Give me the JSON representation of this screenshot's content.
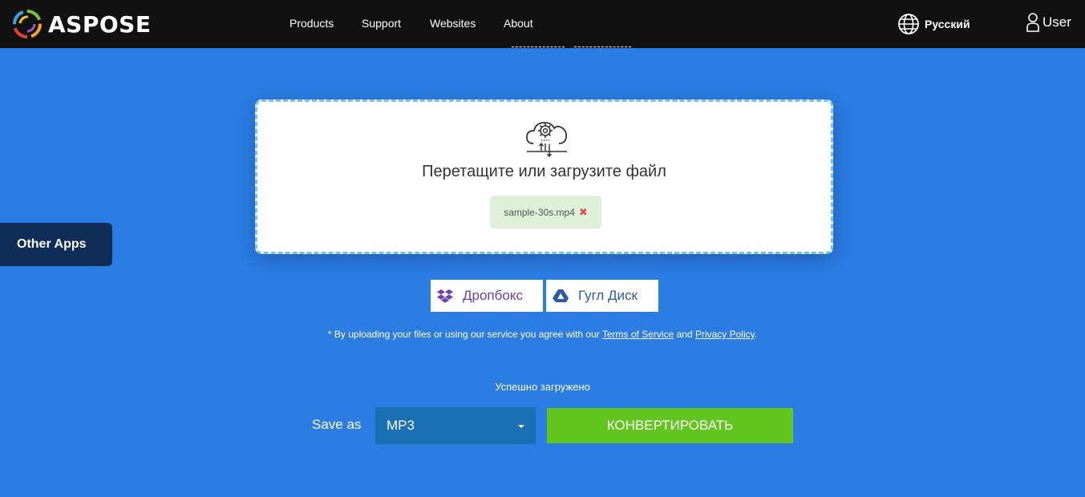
{
  "header": {
    "brand": "ASPOSE",
    "nav": [
      {
        "label": "Products"
      },
      {
        "label": "Support"
      },
      {
        "label": "Websites"
      },
      {
        "label": "About"
      }
    ],
    "language": "Русский",
    "user": "User"
  },
  "sidebar": {
    "other_apps": "Other Apps"
  },
  "dropzone": {
    "title": "Перетащите или загрузите файл",
    "file_name": "sample-30s.mp4",
    "remove_symbol": "✖"
  },
  "cloud": {
    "dropbox": "Дропбокс",
    "gdrive": "Гугл Диск"
  },
  "terms": {
    "prefix": "* By uploading your files or using our service you agree with our",
    "tos": "Terms of Service",
    "and": "and",
    "privacy": "Privacy Policy",
    "suffix": "."
  },
  "status": "Успешно загружено",
  "convert": {
    "save_as_label": "Save as",
    "format": "MP3",
    "button": "КОНВЕРТИРОВАТЬ"
  },
  "colors": {
    "background": "#2b7ce3",
    "header": "#111111",
    "convert_button": "#62c51e",
    "select": "#1b6fb3",
    "other_apps": "#0f2d57",
    "file_chip": "#dff0d8"
  }
}
